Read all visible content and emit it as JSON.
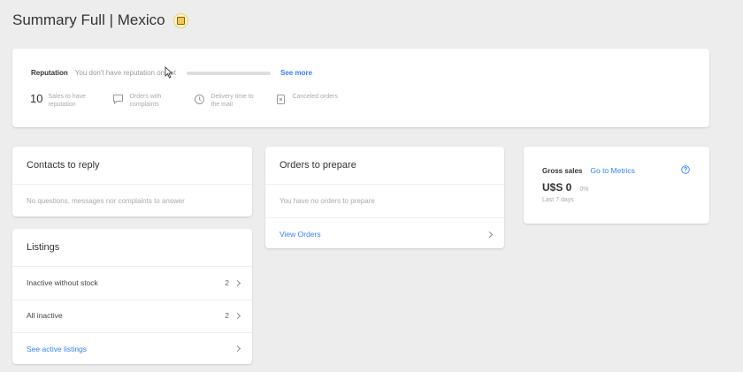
{
  "page": {
    "title": "Summary Full | Mexico",
    "flag_icon": "mexico-flag-icon"
  },
  "reputation": {
    "label": "Reputation",
    "message": "You don't have reputation on yet",
    "see_more": "See more",
    "stats": [
      {
        "value": "10",
        "label": "Sales to have reputation",
        "icon": ""
      },
      {
        "value": "",
        "label": "Orders with complaints",
        "icon": "chat-icon"
      },
      {
        "value": "",
        "label": "Delivery time to the mail",
        "icon": "clock-icon"
      },
      {
        "value": "",
        "label": "Canceled orders",
        "icon": "cancel-icon"
      }
    ]
  },
  "contacts": {
    "title": "Contacts to reply",
    "empty": "No questions, messages nor complaints to answer"
  },
  "orders": {
    "title": "Orders to prepare",
    "empty": "You have no orders to prepare",
    "link": "View Orders"
  },
  "gross": {
    "label": "Gross sales",
    "link": "Go to Metrics",
    "amount": "U$S 0",
    "pct": "0%",
    "period": "Last 7 days"
  },
  "listings": {
    "title": "Listings",
    "rows": [
      {
        "label": "Inactive without stock",
        "count": "2"
      },
      {
        "label": "All inactive",
        "count": "2"
      }
    ],
    "link": "See active listings"
  },
  "colors": {
    "accent": "#3483fa",
    "background": "#ededed",
    "card": "#ffffff"
  }
}
